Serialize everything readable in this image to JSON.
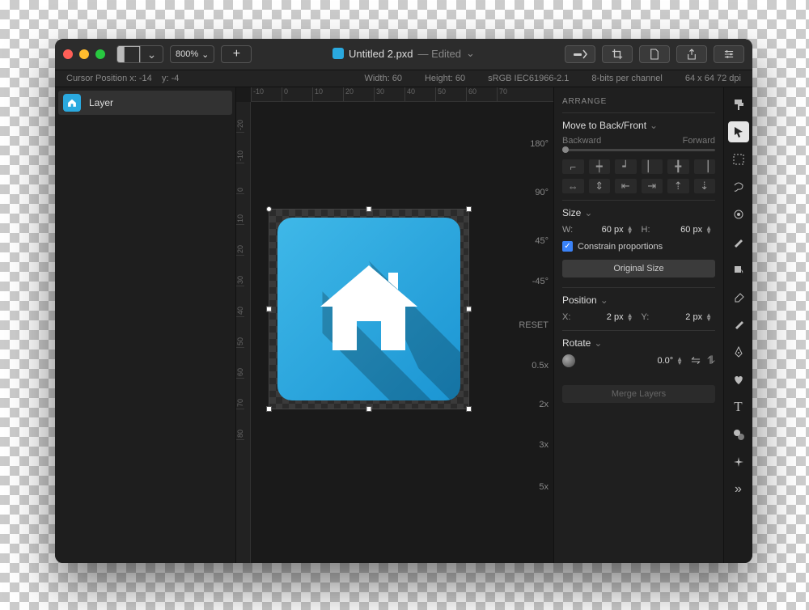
{
  "titlebar": {
    "zoom": "800%",
    "plus": "+",
    "filename": "Untitled 2.pxd",
    "status": "— Edited",
    "chevron": "⌄"
  },
  "infobar": {
    "cursor_label": "Cursor Position x:",
    "cursor_x": "-14",
    "cursor_y_label": "y:",
    "cursor_y": "-4",
    "width_label": "Width:",
    "width": "60",
    "height_label": "Height:",
    "height": "60",
    "colorspace": "sRGB IEC61966-2.1",
    "depth": "8-bits per channel",
    "dims": "64 x 64 72 dpi"
  },
  "layers": {
    "item0": "Layer"
  },
  "ruler_top": [
    "-10",
    "0",
    "10",
    "20",
    "30",
    "40",
    "50",
    "60",
    "70"
  ],
  "ruler_left": [
    "-20",
    "-10",
    "0",
    "10",
    "20",
    "30",
    "40",
    "50",
    "60",
    "70",
    "80"
  ],
  "rotations": {
    "r180": "180°",
    "r90": "90°",
    "r45": "45°",
    "rn45": "-45°",
    "reset": "RESET",
    "x05": "0.5x",
    "x2": "2x",
    "x3": "3x",
    "x5": "5x"
  },
  "inspector": {
    "arrange": "ARRANGE",
    "move": "Move to Back/Front",
    "backward": "Backward",
    "forward": "Forward",
    "size": "Size",
    "w_label": "W:",
    "w_val": "60 px",
    "h_label": "H:",
    "h_val": "60 px",
    "constrain": "Constrain proportions",
    "original": "Original Size",
    "position": "Position",
    "x_label": "X:",
    "x_val": "2 px",
    "y_label": "Y:",
    "y_val": "2 px",
    "rotate": "Rotate",
    "angle": "0.0°",
    "merge": "Merge Layers"
  }
}
